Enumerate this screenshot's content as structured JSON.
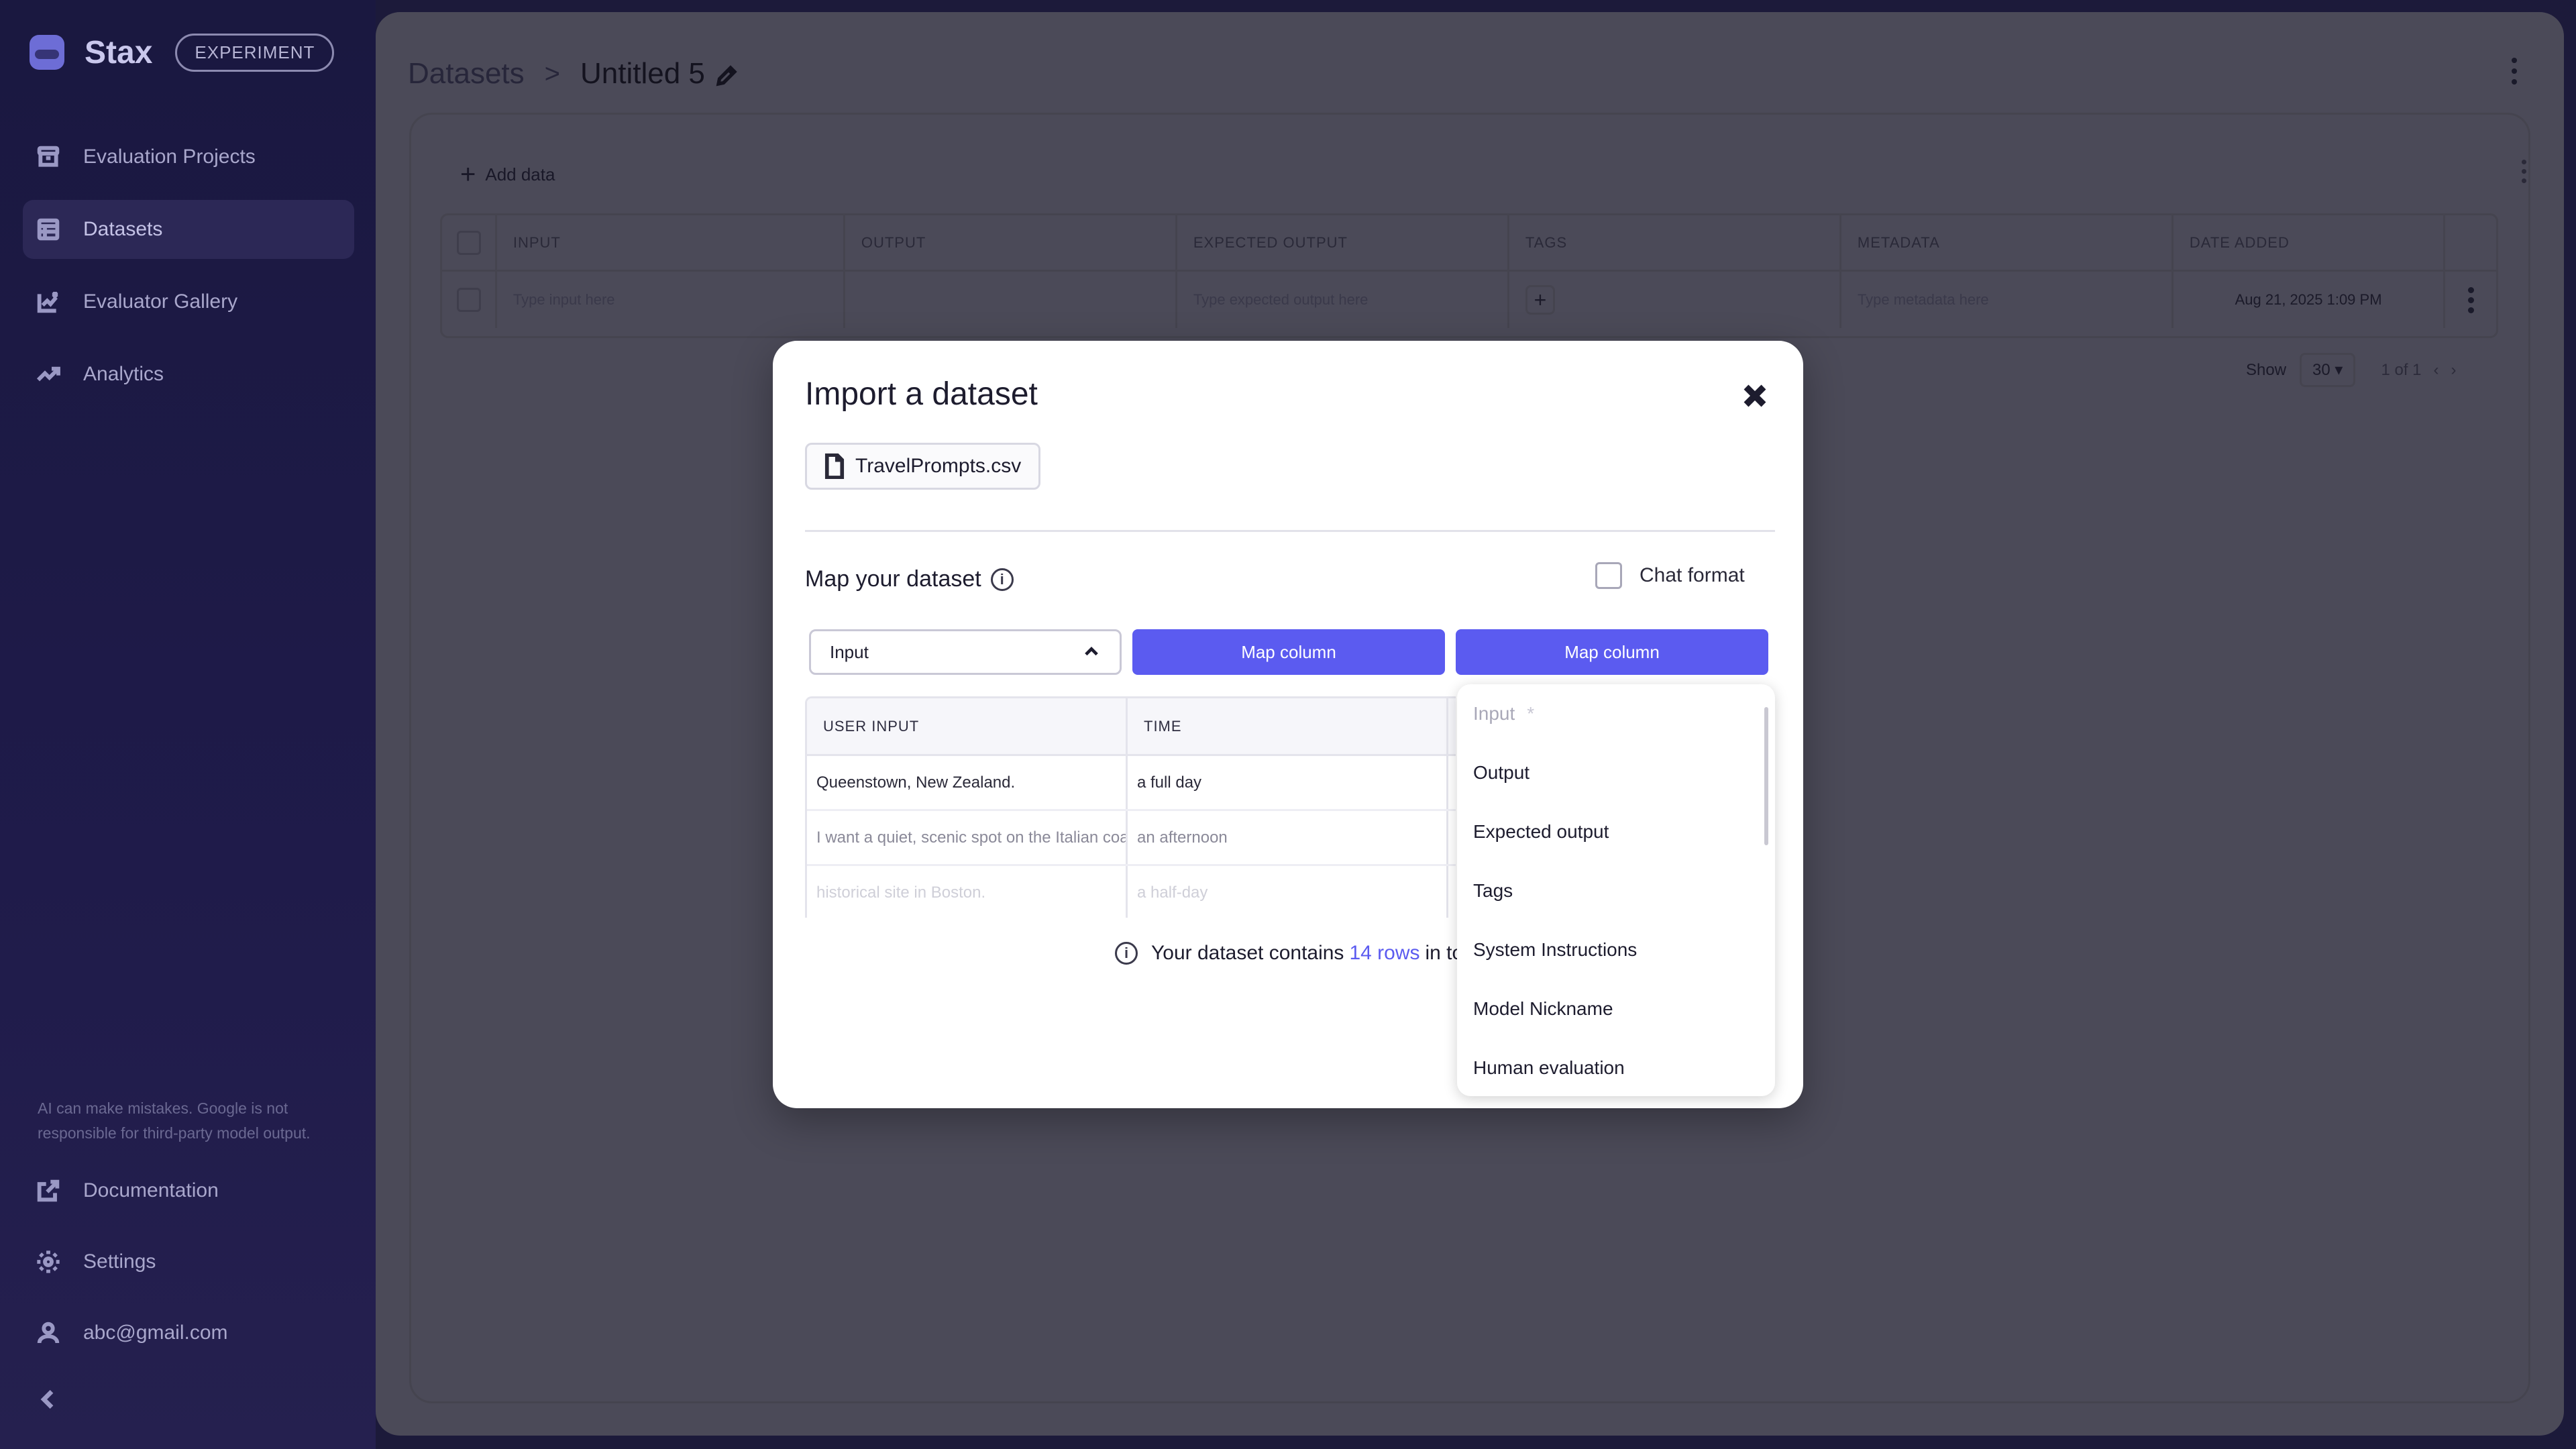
{
  "sidebar": {
    "brand": "Stax",
    "badge": "EXPERIMENT",
    "items": [
      {
        "label": "Evaluation Projects"
      },
      {
        "label": "Datasets"
      },
      {
        "label": "Evaluator Gallery"
      },
      {
        "label": "Analytics"
      }
    ],
    "disclaimer": "AI can make mistakes. Google is not responsible for third-party model output.",
    "bottom": [
      {
        "label": "Documentation"
      },
      {
        "label": "Settings"
      },
      {
        "label": "abc@gmail.com"
      }
    ]
  },
  "header": {
    "breadcrumb_root": "Datasets",
    "breadcrumb_separator": ">",
    "title": "Untitled 5"
  },
  "panel": {
    "add_data": "Add data",
    "columns": [
      "INPUT",
      "OUTPUT",
      "EXPECTED OUTPUT",
      "TAGS",
      "METADATA",
      "DATE ADDED"
    ],
    "row": {
      "input_placeholder": "Type input here",
      "expected_placeholder": "Type expected output here",
      "metadata_placeholder": "Type metadata here",
      "date": "Aug 21, 2025 1:09 PM"
    },
    "pager": {
      "show_label": "Show",
      "page_size": "30",
      "page_info": "1 of 1"
    }
  },
  "modal": {
    "title": "Import a dataset",
    "file_name": "TravelPrompts.csv",
    "map_title": "Map your dataset",
    "chat_format": "Chat format",
    "select_value": "Input",
    "map_button_1": "Map column",
    "map_button_2": "Map column",
    "preview_headers": [
      "USER INPUT",
      "TIME"
    ],
    "preview_rows": [
      [
        "Queenstown, New Zealand.",
        "a full day"
      ],
      [
        "I want a quiet, scenic spot on the Italian coast",
        "an afternoon"
      ],
      [
        "historical site in Boston.",
        "a half-day"
      ]
    ],
    "summary_prefix": "Your dataset contains",
    "summary_rows": "14 rows",
    "summary_suffix": "in total"
  },
  "dropdown": {
    "items": [
      {
        "label": "Input",
        "disabled": true
      },
      {
        "label": "Output"
      },
      {
        "label": "Expected output"
      },
      {
        "label": "Tags"
      },
      {
        "label": "System Instructions"
      },
      {
        "label": "Model Nickname"
      },
      {
        "label": "Human evaluation"
      }
    ],
    "required_marker": "*"
  },
  "colors": {
    "accent": "#5b5bf0",
    "sidebar_bg": "#1a1840"
  }
}
